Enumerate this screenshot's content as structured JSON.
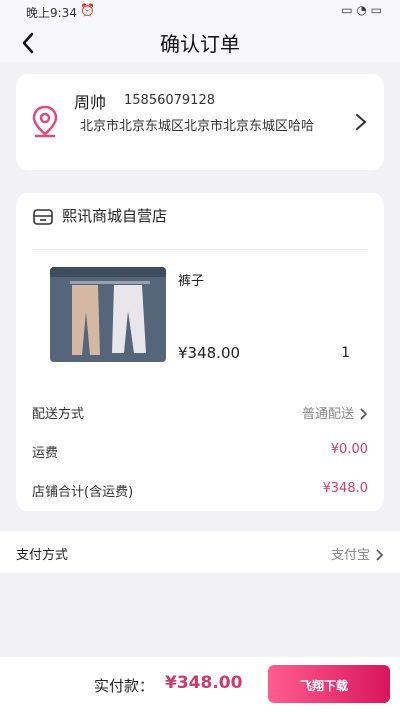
{
  "statusbar": {
    "time": "晚上9:34"
  },
  "header": {
    "title": "确认订单"
  },
  "address": {
    "name": "周帅",
    "phone": "15856079128",
    "text": "北京市北京东城区北京市北京东城区哈哈"
  },
  "shop": {
    "name": "熙讯商城自营店",
    "item": {
      "name": "裤子",
      "price": "¥348.00",
      "qty": "1"
    }
  },
  "shipping": {
    "label": "配送方式",
    "value": "普通配送"
  },
  "freight": {
    "label": "运费",
    "value": "¥0.00"
  },
  "subtotal": {
    "label": "店铺合计(含运费)",
    "value": "¥348.0"
  },
  "payment": {
    "label": "支付方式",
    "value": "支付宝"
  },
  "footer": {
    "total_label": "实付款：",
    "total_value": "¥348.00",
    "watermark": "飞翔下载"
  },
  "colors": {
    "accent": "#d03a6b"
  }
}
